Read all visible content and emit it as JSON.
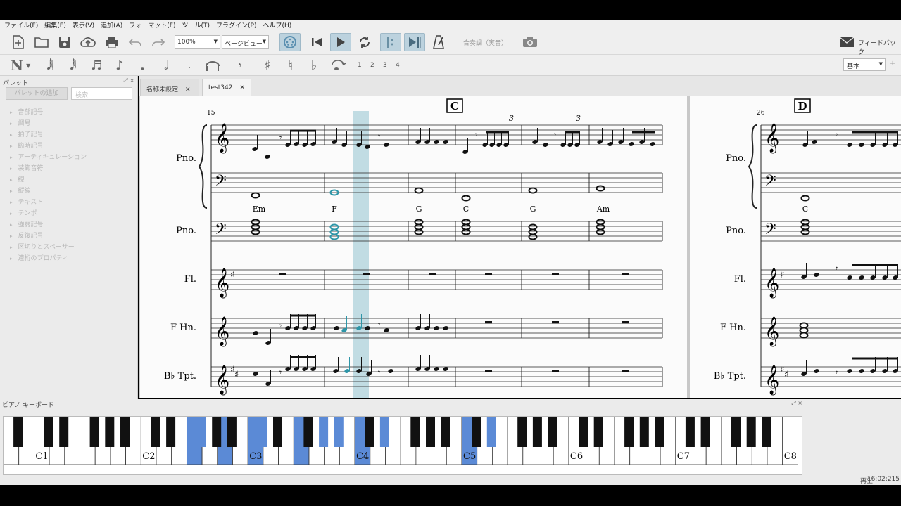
{
  "menu": [
    "ファイル(F)",
    "編集(E)",
    "表示(V)",
    "追加(A)",
    "フォーマット(F)",
    "ツール(T)",
    "プラグイン(P)",
    "ヘルプ(H)"
  ],
  "toolbar": {
    "zoom": "100%",
    "view_mode": "ページビュー",
    "concert_pitch": "合奏調（実音）",
    "feedback": "フィードバック"
  },
  "notebar": {
    "voices": [
      "1",
      "2",
      "3",
      "4"
    ],
    "workspace": "基本"
  },
  "palette": {
    "title": "パレット",
    "add_button": "パレットの追加",
    "search_placeholder": "検索",
    "items": [
      "音部記号",
      "調号",
      "拍子記号",
      "臨時記号",
      "アーティキュレーション",
      "装飾音符",
      "線",
      "縦線",
      "テキスト",
      "テンポ",
      "強弱記号",
      "反復記号",
      "区切りとスペーサー",
      "連桁のプロパティ"
    ]
  },
  "tabs": [
    {
      "label": "名称未設定"
    },
    {
      "label": "test342"
    }
  ],
  "score": {
    "rehearsal_marks": [
      "C",
      "D"
    ],
    "measure_numbers": [
      "15",
      "26"
    ],
    "tuplet_marks": [
      "3",
      "3"
    ],
    "instruments": [
      "Pno.",
      "Pno.",
      "Fl.",
      "F Hn.",
      "B♭ Tpt."
    ],
    "chords_page1": [
      "Em",
      "F",
      "G",
      "C",
      "G",
      "Am"
    ],
    "chords_page2": [
      "C"
    ]
  },
  "keyboard": {
    "title": "ピアノ キーボード",
    "octave_labels": [
      "C1",
      "C2",
      "C3",
      "C4",
      "C5",
      "C6",
      "C7",
      "C8"
    ],
    "highlight_color": "#5b8ad6"
  },
  "status": {
    "state": "再生",
    "time": "16:02:215"
  },
  "colors": {
    "selection": "#a8cfd9",
    "selected_note": "#2e96a8"
  }
}
